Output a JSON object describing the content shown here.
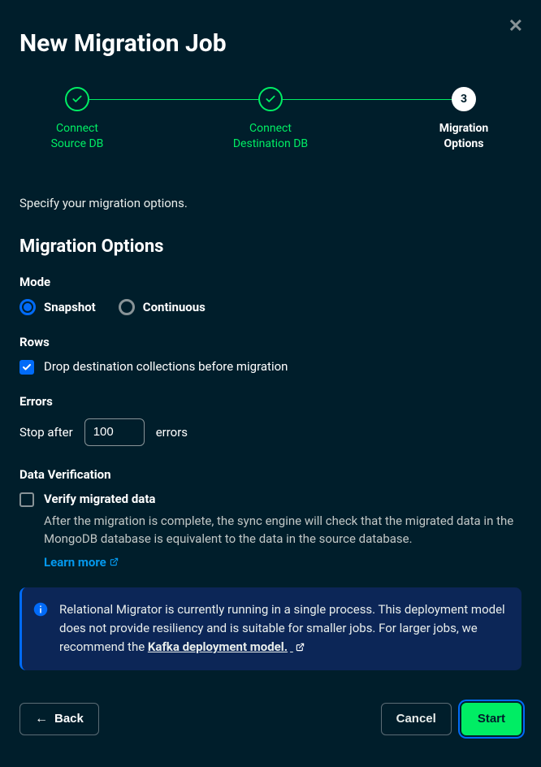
{
  "dialog": {
    "title": "New Migration Job",
    "close_aria": "Close"
  },
  "stepper": {
    "items": [
      {
        "label_line1": "Connect",
        "label_line2": "Source DB",
        "state": "done"
      },
      {
        "label_line1": "Connect",
        "label_line2": "Destination DB",
        "state": "done"
      },
      {
        "label_line1": "Migration",
        "label_line2": "Options",
        "number": "3",
        "state": "current"
      }
    ]
  },
  "instruction": "Specify your migration options.",
  "section": {
    "title": "Migration Options"
  },
  "mode": {
    "label": "Mode",
    "options": [
      {
        "label": "Snapshot",
        "selected": true
      },
      {
        "label": "Continuous",
        "selected": false
      }
    ]
  },
  "rows": {
    "label": "Rows",
    "drop": {
      "text": "Drop destination collections before migration",
      "checked": true
    }
  },
  "errors": {
    "label": "Errors",
    "pretext": "Stop after",
    "value": "100",
    "posttext": "errors"
  },
  "verify": {
    "label": "Data Verification",
    "checkbox_label": "Verify migrated data",
    "checked": false,
    "description": "After the migration is complete, the sync engine will check that the migrated data in the MongoDB database is equivalent to the data in the source database.",
    "learn_more": "Learn more"
  },
  "banner": {
    "text_pre": "Relational Migrator is currently running in a single process. This deployment model does not provide resiliency and is suitable for smaller jobs. For larger jobs, we recommend the ",
    "link": "Kafka deployment model."
  },
  "footer": {
    "back": "Back",
    "cancel": "Cancel",
    "start": "Start"
  },
  "colors": {
    "bg": "#001e2b",
    "accent_green": "#00ed64",
    "accent_blue": "#016bf8",
    "link_blue": "#0498ec",
    "banner_bg": "#0c2657"
  }
}
